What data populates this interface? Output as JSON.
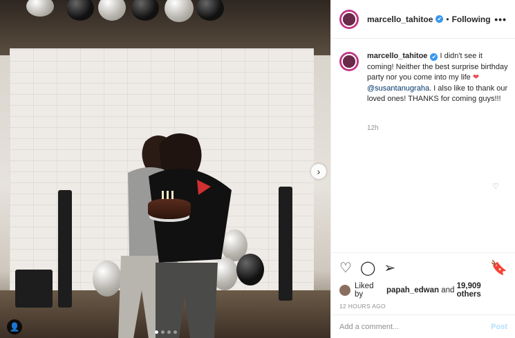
{
  "post": {
    "username": "marcello_tahitoe",
    "verified_icon": "✔",
    "separator": "•",
    "follow_status": "Following",
    "more_icon": "•••",
    "caption_parts": {
      "before": " I didn't see it coming! Neither the best surprise birthday party nor you come into my life ",
      "heart": "❤",
      "mention": "@susantanugraha",
      "after": ". I also like to thank our loved ones! THANKS for coming guys!!!"
    },
    "caption_time": "12h",
    "liked_by_prefix": "Liked by ",
    "liked_by_user": "papah_edwan",
    "liked_by_and": " and ",
    "liked_by_count": "19,909 others",
    "date": "12 HOURS AGO",
    "comment_placeholder": "Add a comment...",
    "post_button": "Post"
  },
  "icons": {
    "heart": "♡",
    "comment": "◯",
    "share": "➢",
    "bookmark": "🔖",
    "next": "›",
    "user_tag": "👤",
    "small_heart": "♡"
  },
  "carousel": {
    "total": 4,
    "active": 1
  },
  "colors": {
    "accent": "#3897f0",
    "heart": "#ed4956",
    "mention": "#003569",
    "post_disabled": "#b2dffc"
  }
}
